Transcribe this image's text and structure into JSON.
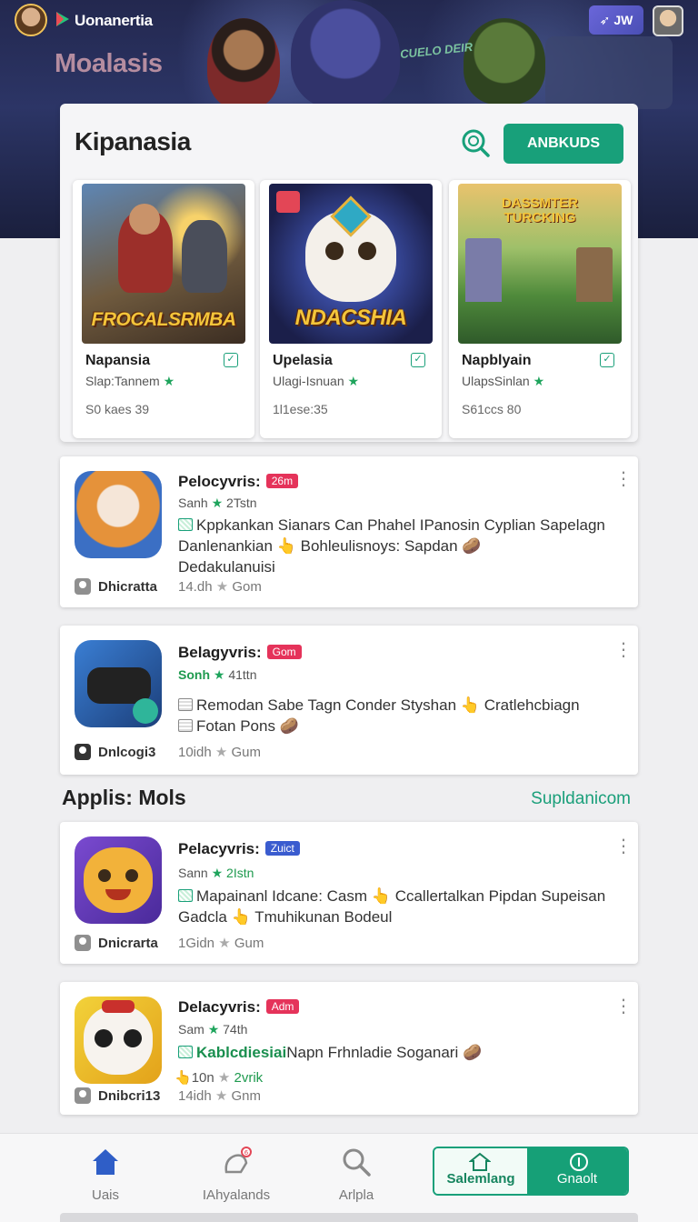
{
  "header": {
    "brand": "Uonanertia",
    "hero_title": "Moalasis",
    "hero_tag": "CUELO DEIR",
    "badge_label": "JW"
  },
  "featured": {
    "title": "Kipanasia",
    "cta_label": "ANBKUDS",
    "games": [
      {
        "logo": "FROCALSRMBA",
        "name": "Napansia",
        "sub": "Slap:Tannem",
        "meta": "S0 kaes 39"
      },
      {
        "logo": "NDACSHIA",
        "name": "Upelasia",
        "sub": "Ulagi-Isnuan",
        "meta": "1l1ese:35"
      },
      {
        "logo": "DASSMTER TURCKING",
        "name": "Napblyain",
        "sub": "UlapsSinlan",
        "meta": "S61ccs 80"
      }
    ]
  },
  "apps_top": [
    {
      "name": "Pelocyvris:",
      "badge": "26m",
      "badge_color": "#e5335a",
      "rating": "Sanh",
      "rating_num": "2Tstn",
      "desc_line1": "Kppkankan Sianars Can Phahel IPanosin Cyplian Sapelagn",
      "desc_line2": "Danlenankian",
      "desc_line2b": "Bohleulisnoys: Sapdan",
      "desc_line3": "Dedakulanuisi",
      "author": "Dhicratta",
      "downloads": "14.dh",
      "dl_unit": "Gom"
    },
    {
      "name": "Belagyvris:",
      "badge": "Gom",
      "badge_color": "#e5335a",
      "rating": "Sonh",
      "rating_num": "41ttn",
      "desc_line1": "Remodan Sabe Tagn Conder Styshan",
      "desc_line1b": "Cratlehcbiagn",
      "desc_line2": "Fotan Pons",
      "author": "Dnlcogi3",
      "downloads": "10idh",
      "dl_unit": "Gum"
    }
  ],
  "section": {
    "title": "Applis: Mols",
    "link": "Supldanicom"
  },
  "apps_bottom": [
    {
      "name": "Pelacyvris:",
      "badge": "Zuict",
      "badge_color": "#3a5ccf",
      "rating": "Sann",
      "rating_num": "2Istn",
      "desc_line1": "Mapainanl Idcane: Casm",
      "desc_line1b": "Ccallertalkan Pipdan Supeisan",
      "desc_line2": "Gadcla",
      "desc_line2b": "Tmuhikunan Bodeul",
      "author": "Dnicrarta",
      "downloads": "1Gidn",
      "dl_unit": "Gum"
    },
    {
      "name": "Delacyvris:",
      "badge": "Adm",
      "badge_color": "#e5335a",
      "rating": "Sam",
      "rating_num": "74th",
      "desc_highlight": "Kablcdiesiai",
      "desc_line1": "Napn Frhnladie Soganari",
      "desc_line2": "10n",
      "desc_line2b": "2vrik",
      "author": "Dnibcri13",
      "downloads": "14idh",
      "dl_unit": "Gnm"
    }
  ],
  "bottom_nav": {
    "items": [
      "Uais",
      "IAhyalands",
      "Arlpla"
    ],
    "split_left": "Salemlang",
    "split_right": "Gnaolt"
  }
}
